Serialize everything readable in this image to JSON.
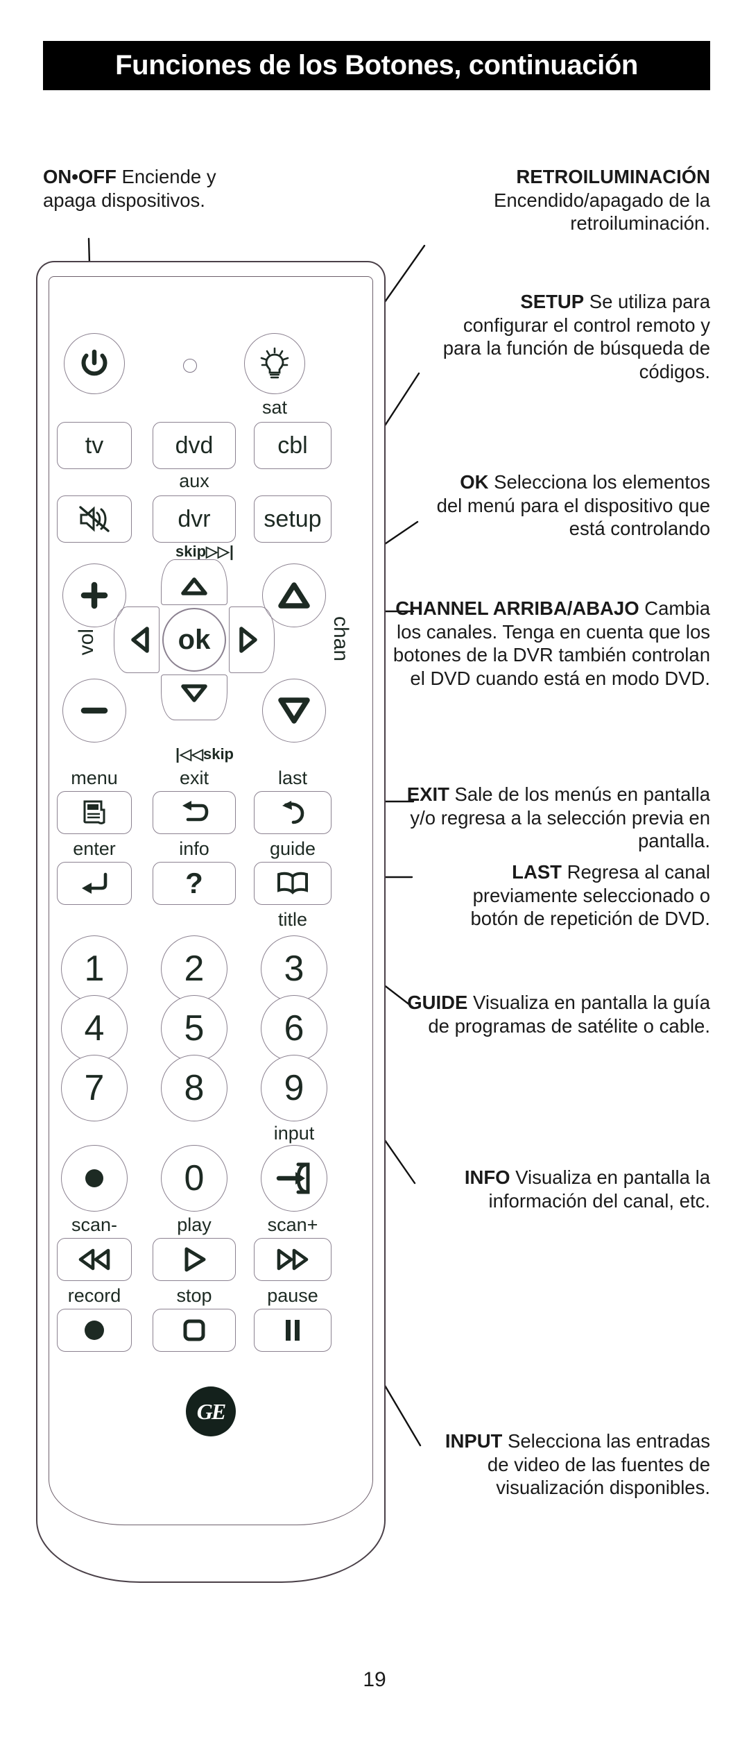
{
  "header": {
    "title": "Funciones de los Botones, continuación"
  },
  "page_number": "19",
  "notes": {
    "on_off": {
      "term": "ON•OFF",
      "body": " Enciende y apaga dispositivos."
    },
    "retro": {
      "term": "RETROILUMINACIÓN",
      "body": " Encendido/apagado de la retroiluminación."
    },
    "setup": {
      "term": "SETUP",
      "body": " Se utiliza para configurar el control remoto y para la función de búsqueda de códigos."
    },
    "ok": {
      "term": "OK",
      "body": " Selecciona los elementos del menú para el dispositivo que está controlando"
    },
    "channel": {
      "term": "CHANNEL ARRIBA/ABAJO",
      "body": " Cambia los canales. Tenga en cuenta que los botones de la DVR también controlan el DVD cuando está en modo DVD."
    },
    "exit": {
      "term": "EXIT",
      "body": " Sale de los menús en pantalla y/o regresa a la selección previa en pantalla."
    },
    "last": {
      "term": "LAST",
      "body": " Regresa al canal previamente seleccionado o botón de repetición de DVD."
    },
    "guide": {
      "term": "GUIDE",
      "body": " Visualiza en pantalla la guía de programas de satélite o cable."
    },
    "info": {
      "term": "INFO",
      "body": " Visualiza en pantalla la información del canal, etc."
    },
    "input": {
      "term": "INPUT",
      "body": " Selecciona las entradas de video de las fuentes de visualización disponibles."
    }
  },
  "remote": {
    "brand": "GE",
    "captions": {
      "sat": "sat",
      "aux": "aux",
      "vol": "vol",
      "chan": "chan",
      "skip_fwd": "skip▷▷|",
      "skip_back": "|◁◁skip",
      "menu": "menu",
      "exit": "exit",
      "last": "last",
      "enter": "enter",
      "info": "info",
      "guide": "guide",
      "title": "title",
      "input": "input",
      "scan_minus": "scan-",
      "play": "play",
      "scan_plus": "scan+",
      "record": "record",
      "stop": "stop",
      "pause": "pause"
    },
    "buttons": {
      "power": "power-icon",
      "backlight": "lightbulb-icon",
      "tv": "tv",
      "dvd": "dvd",
      "cbl": "cbl",
      "mute": "mute-icon",
      "dvr": "dvr",
      "setup": "setup",
      "vol_up": "+",
      "vol_down": "−",
      "ok": "ok",
      "num_1": "1",
      "num_2": "2",
      "num_3": "3",
      "num_4": "4",
      "num_5": "5",
      "num_6": "6",
      "num_7": "7",
      "num_8": "8",
      "num_9": "9",
      "num_0": "0",
      "dot": "•"
    }
  },
  "colors": {
    "banner_bg": "#000000",
    "banner_text": "#ffffff",
    "ink": "#1a1a1a",
    "button_outline": "#8b8190",
    "shell_outline": "#4a4048"
  }
}
